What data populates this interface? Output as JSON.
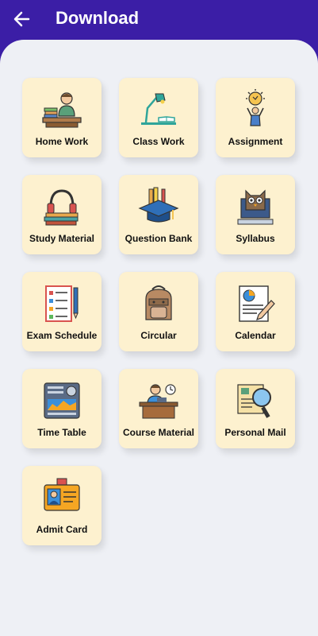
{
  "header": {
    "title": "Download",
    "back_icon": "arrow-left-icon"
  },
  "colors": {
    "appbar": "#3b1ea6",
    "background": "#eef0f5",
    "tile": "#fdf1cf"
  },
  "tiles": [
    {
      "label": "Home Work",
      "icon": "student-desk-icon"
    },
    {
      "label": "Class Work",
      "icon": "desk-lamp-icon"
    },
    {
      "label": "Assignment",
      "icon": "idea-person-icon"
    },
    {
      "label": "Study Material",
      "icon": "headphones-books-icon"
    },
    {
      "label": "Question Bank",
      "icon": "graduation-cap-icon"
    },
    {
      "label": "Syllabus",
      "icon": "owl-monitor-icon"
    },
    {
      "label": "Exam Schedule",
      "icon": "checklist-icon"
    },
    {
      "label": "Circular",
      "icon": "backpack-icon"
    },
    {
      "label": "Calendar",
      "icon": "report-chart-icon"
    },
    {
      "label": "Time Table",
      "icon": "newspaper-icon"
    },
    {
      "label": "Course Material",
      "icon": "teacher-desk-icon"
    },
    {
      "label": "Personal Mail",
      "icon": "magnifier-document-icon"
    },
    {
      "label": "Admit Card",
      "icon": "id-card-icon"
    }
  ]
}
